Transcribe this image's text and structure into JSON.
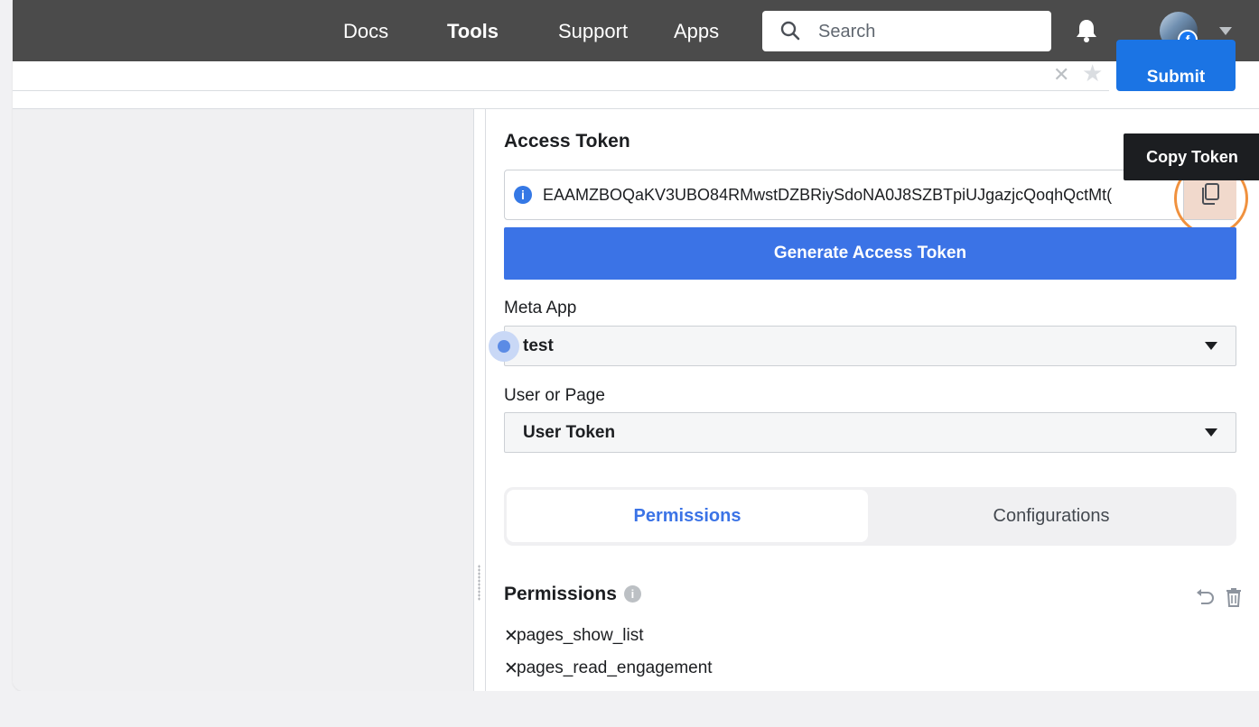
{
  "nav": {
    "links": [
      "Docs",
      "Tools",
      "Support",
      "Apps"
    ],
    "search_placeholder": "Search"
  },
  "query_bar": {
    "submit_label": "Submit"
  },
  "access_token": {
    "title": "Access Token",
    "value": "EAAMZBOQaKV3UBO84RMwstDZBRiySdoNA0J8SZBTpiUJgazjcQoqhQctMt(",
    "copy_tooltip": "Copy Token",
    "generate_label": "Generate Access Token"
  },
  "meta_app": {
    "label": "Meta App",
    "value": "test"
  },
  "user_or_page": {
    "label": "User or Page",
    "value": "User Token"
  },
  "tabs": [
    "Permissions",
    "Configurations"
  ],
  "permissions": {
    "title": "Permissions",
    "items": [
      "pages_show_list",
      "pages_read_engagement"
    ]
  },
  "colors": {
    "nav_bg": "#4b4b4b",
    "primary": "#3b73e6",
    "highlight_ring": "#f0913e"
  },
  "icons": [
    "search-icon",
    "bell-icon",
    "facebook-icon",
    "copy-icon",
    "info-icon",
    "undo-icon",
    "trash-icon",
    "chevron-down-icon",
    "close-icon",
    "star-icon"
  ]
}
